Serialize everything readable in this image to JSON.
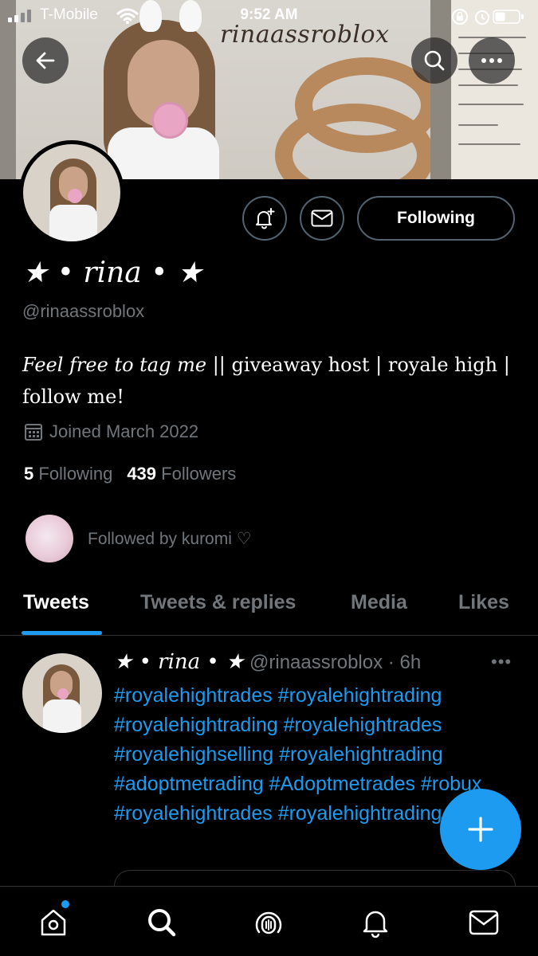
{
  "status_bar": {
    "carrier": "T-Mobile",
    "time": "9:52 AM"
  },
  "banner": {
    "title_text": "rinaassroblox"
  },
  "profile": {
    "display_name": "★ • rina • ★",
    "handle": "@rinaassroblox",
    "bio_italic": "Feel free to tag me",
    "bio_rest": " || giveaway host | royale high | follow me!",
    "joined": "Joined March 2022",
    "following_count": "5",
    "following_label": "Following",
    "followers_count": "439",
    "followers_label": "Followers",
    "followed_by": "Followed by kuromi ♡",
    "follow_button_label": "Following"
  },
  "tabs": [
    "Tweets",
    "Tweets & replies",
    "Media",
    "Likes"
  ],
  "tweet": {
    "author_name": "★ • rina • ★",
    "author_handle": "@rinaassroblox",
    "separator": "·",
    "time": "6h",
    "more": "•••",
    "text": "#royalehightrades #royalehightrading #royalehightrading #royalehightrades #royalehighselling #royalehightrading #adoptmetrading #Adoptmetrades #robux #royalehightrades #royalehightrading"
  },
  "icons": {
    "back": "arrow-left-icon",
    "search": "search-icon",
    "more": "more-horizontal-icon",
    "notify": "bell-plus-icon",
    "message": "mail-icon",
    "calendar": "calendar-icon",
    "compose": "plus-icon",
    "nav": [
      "home-icon",
      "search-icon",
      "spaces-icon",
      "bell-icon",
      "mail-icon"
    ]
  },
  "colors": {
    "accent": "#1d9bf0",
    "background": "#000000",
    "muted": "#71767b"
  }
}
